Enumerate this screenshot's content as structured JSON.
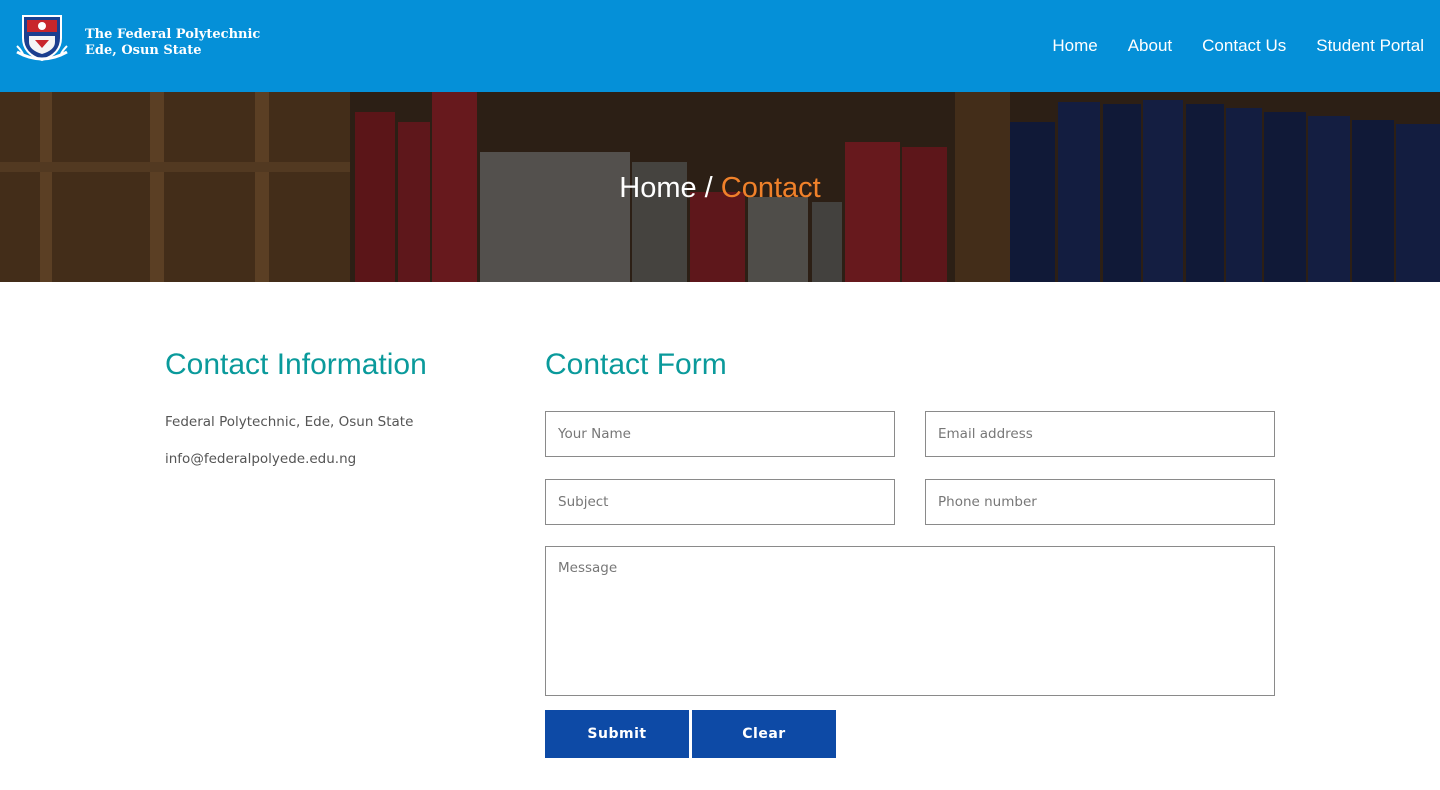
{
  "header": {
    "brand_line1": "The Federal Polytechnic",
    "brand_line2": "Ede, Osun State",
    "bg_color": "#0590d8",
    "nav": [
      {
        "label": "Home"
      },
      {
        "label": "About"
      },
      {
        "label": "Contact Us"
      },
      {
        "label": "Student Portal"
      }
    ]
  },
  "banner": {
    "crumb_home": "Home",
    "separator": " / ",
    "crumb_current": "Contact",
    "accent_color": "#f0812a"
  },
  "contact_info": {
    "heading": "Contact Information",
    "address": "Federal Polytechnic, Ede, Osun State",
    "email": "info@federalpolyede.edu.ng"
  },
  "contact_form": {
    "heading": "Contact Form",
    "name_placeholder": "Your Name",
    "email_placeholder": "Email address",
    "subject_placeholder": "Subject",
    "phone_placeholder": "Phone number",
    "message_placeholder": "Message",
    "submit_label": "Submit",
    "clear_label": "Clear",
    "button_color": "#0d4aa6",
    "heading_color": "#0a9a9b"
  }
}
